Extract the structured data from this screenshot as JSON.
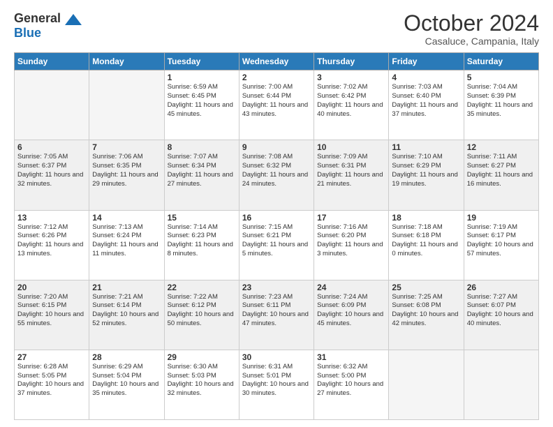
{
  "header": {
    "logo_general": "General",
    "logo_blue": "Blue",
    "month_title": "October 2024",
    "location": "Casaluce, Campania, Italy"
  },
  "days_of_week": [
    "Sunday",
    "Monday",
    "Tuesday",
    "Wednesday",
    "Thursday",
    "Friday",
    "Saturday"
  ],
  "weeks": [
    [
      {
        "day": "",
        "empty": true
      },
      {
        "day": "",
        "empty": true
      },
      {
        "day": "1",
        "sunrise": "6:59 AM",
        "sunset": "6:45 PM",
        "daylight": "11 hours and 45 minutes."
      },
      {
        "day": "2",
        "sunrise": "7:00 AM",
        "sunset": "6:44 PM",
        "daylight": "11 hours and 43 minutes."
      },
      {
        "day": "3",
        "sunrise": "7:02 AM",
        "sunset": "6:42 PM",
        "daylight": "11 hours and 40 minutes."
      },
      {
        "day": "4",
        "sunrise": "7:03 AM",
        "sunset": "6:40 PM",
        "daylight": "11 hours and 37 minutes."
      },
      {
        "day": "5",
        "sunrise": "7:04 AM",
        "sunset": "6:39 PM",
        "daylight": "11 hours and 35 minutes."
      }
    ],
    [
      {
        "day": "6",
        "sunrise": "7:05 AM",
        "sunset": "6:37 PM",
        "daylight": "11 hours and 32 minutes."
      },
      {
        "day": "7",
        "sunrise": "7:06 AM",
        "sunset": "6:35 PM",
        "daylight": "11 hours and 29 minutes."
      },
      {
        "day": "8",
        "sunrise": "7:07 AM",
        "sunset": "6:34 PM",
        "daylight": "11 hours and 27 minutes."
      },
      {
        "day": "9",
        "sunrise": "7:08 AM",
        "sunset": "6:32 PM",
        "daylight": "11 hours and 24 minutes."
      },
      {
        "day": "10",
        "sunrise": "7:09 AM",
        "sunset": "6:31 PM",
        "daylight": "11 hours and 21 minutes."
      },
      {
        "day": "11",
        "sunrise": "7:10 AM",
        "sunset": "6:29 PM",
        "daylight": "11 hours and 19 minutes."
      },
      {
        "day": "12",
        "sunrise": "7:11 AM",
        "sunset": "6:27 PM",
        "daylight": "11 hours and 16 minutes."
      }
    ],
    [
      {
        "day": "13",
        "sunrise": "7:12 AM",
        "sunset": "6:26 PM",
        "daylight": "11 hours and 13 minutes."
      },
      {
        "day": "14",
        "sunrise": "7:13 AM",
        "sunset": "6:24 PM",
        "daylight": "11 hours and 11 minutes."
      },
      {
        "day": "15",
        "sunrise": "7:14 AM",
        "sunset": "6:23 PM",
        "daylight": "11 hours and 8 minutes."
      },
      {
        "day": "16",
        "sunrise": "7:15 AM",
        "sunset": "6:21 PM",
        "daylight": "11 hours and 5 minutes."
      },
      {
        "day": "17",
        "sunrise": "7:16 AM",
        "sunset": "6:20 PM",
        "daylight": "11 hours and 3 minutes."
      },
      {
        "day": "18",
        "sunrise": "7:18 AM",
        "sunset": "6:18 PM",
        "daylight": "11 hours and 0 minutes."
      },
      {
        "day": "19",
        "sunrise": "7:19 AM",
        "sunset": "6:17 PM",
        "daylight": "10 hours and 57 minutes."
      }
    ],
    [
      {
        "day": "20",
        "sunrise": "7:20 AM",
        "sunset": "6:15 PM",
        "daylight": "10 hours and 55 minutes."
      },
      {
        "day": "21",
        "sunrise": "7:21 AM",
        "sunset": "6:14 PM",
        "daylight": "10 hours and 52 minutes."
      },
      {
        "day": "22",
        "sunrise": "7:22 AM",
        "sunset": "6:12 PM",
        "daylight": "10 hours and 50 minutes."
      },
      {
        "day": "23",
        "sunrise": "7:23 AM",
        "sunset": "6:11 PM",
        "daylight": "10 hours and 47 minutes."
      },
      {
        "day": "24",
        "sunrise": "7:24 AM",
        "sunset": "6:09 PM",
        "daylight": "10 hours and 45 minutes."
      },
      {
        "day": "25",
        "sunrise": "7:25 AM",
        "sunset": "6:08 PM",
        "daylight": "10 hours and 42 minutes."
      },
      {
        "day": "26",
        "sunrise": "7:27 AM",
        "sunset": "6:07 PM",
        "daylight": "10 hours and 40 minutes."
      }
    ],
    [
      {
        "day": "27",
        "sunrise": "6:28 AM",
        "sunset": "5:05 PM",
        "daylight": "10 hours and 37 minutes."
      },
      {
        "day": "28",
        "sunrise": "6:29 AM",
        "sunset": "5:04 PM",
        "daylight": "10 hours and 35 minutes."
      },
      {
        "day": "29",
        "sunrise": "6:30 AM",
        "sunset": "5:03 PM",
        "daylight": "10 hours and 32 minutes."
      },
      {
        "day": "30",
        "sunrise": "6:31 AM",
        "sunset": "5:01 PM",
        "daylight": "10 hours and 30 minutes."
      },
      {
        "day": "31",
        "sunrise": "6:32 AM",
        "sunset": "5:00 PM",
        "daylight": "10 hours and 27 minutes."
      },
      {
        "day": "",
        "empty": true
      },
      {
        "day": "",
        "empty": true
      }
    ]
  ],
  "labels": {
    "sunrise": "Sunrise:",
    "sunset": "Sunset:",
    "daylight": "Daylight:"
  }
}
